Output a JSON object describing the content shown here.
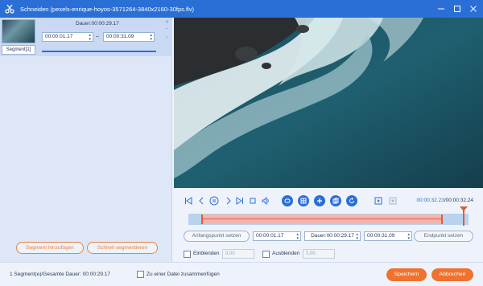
{
  "window": {
    "title": "Schneiden (pexels-enrique-hoyos-3571264-3840x2160-30fps.flv)",
    "controls": [
      "minimize-icon",
      "maximize-icon",
      "close-icon"
    ]
  },
  "segment": {
    "label": "Segment[1]",
    "dauer_label": "Dauer:00:00:29.17",
    "start": "00:00:01.17",
    "end": "00:00:31.09",
    "dash": "–"
  },
  "left_buttons": {
    "add": "Segment hinzufügen",
    "fast": "Schnell segmentieren"
  },
  "player": {
    "current_time": "00:00:32.23",
    "separator": "/",
    "total_time": "00:00:32.24"
  },
  "trim": {
    "set_start": "Anfangspunkt setzen",
    "start": "00:00:01.17",
    "dauer": "Dauer:00:00:29.17",
    "end": "00:00:31.09",
    "set_end": "Endpunkt setzen"
  },
  "fade": {
    "fade_in_label": "Einblenden",
    "fade_in_value": "3,00",
    "fade_out_label": "Ausblenden",
    "fade_out_value": "3,00"
  },
  "footer": {
    "info": "1 Segment(e)/Gesamte Dauer: 00:00:29.17",
    "merge_label": "Zu einer Datei zusammenfügen",
    "save": "Speichern",
    "cancel": "Abbrechen"
  },
  "colors": {
    "title_bar": "#2a6fd6",
    "accent": "#f0722e",
    "selection": "#e65a3a"
  }
}
